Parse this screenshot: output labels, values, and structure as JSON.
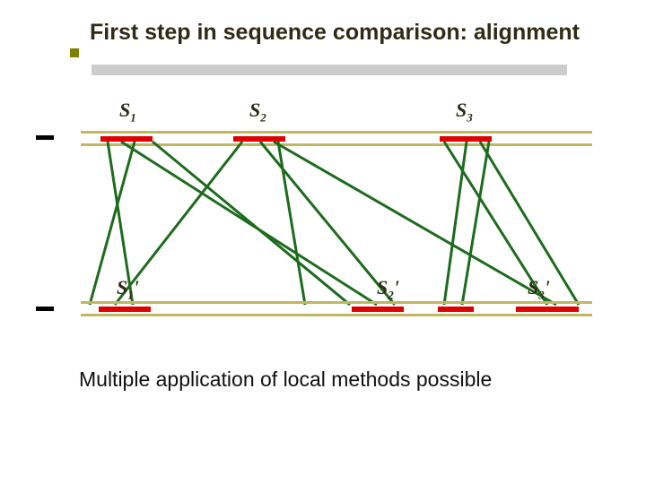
{
  "title": "First step in sequence comparison: alignment",
  "footer": "Multiple application of local methods possible",
  "labels": {
    "top": [
      {
        "s": "S",
        "n": "1"
      },
      {
        "s": "S",
        "n": "2"
      },
      {
        "s": "S",
        "n": "3"
      }
    ],
    "bottom": [
      {
        "s": "S",
        "n": "1",
        "p": "'"
      },
      {
        "s": "S",
        "n": "2",
        "p": "'"
      },
      {
        "s": "S",
        "n": "3",
        "p": "'"
      }
    ]
  }
}
